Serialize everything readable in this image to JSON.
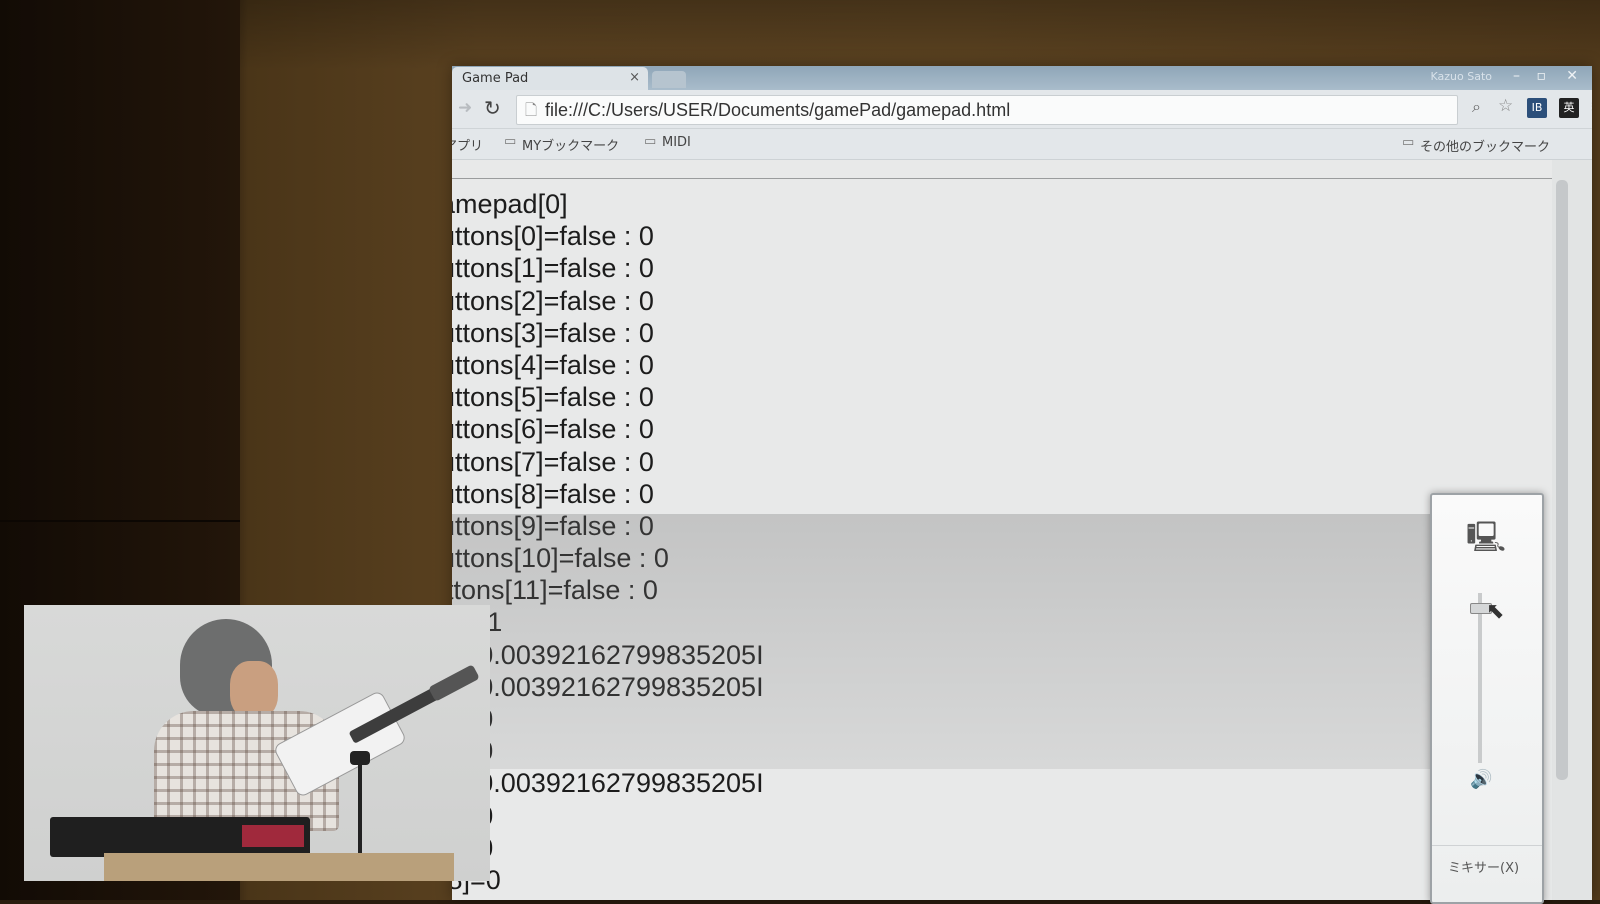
{
  "browser": {
    "tab_title": "Game Pad",
    "tab_close": "×",
    "window_user": "Kazuo Sato",
    "url": "file:///C:/Users/USER/Documents/gamePad/gamepad.html",
    "bookmarks": {
      "apps": "アプリ",
      "folder1": "MYブックマーク",
      "folder2": "MIDI",
      "other": "その他のブックマーク"
    }
  },
  "page": {
    "lines": [
      "amepad[0]",
      "uttons[0]=false : 0",
      "uttons[1]=false : 0",
      "uttons[2]=false : 0",
      "uttons[3]=false : 0",
      "uttons[4]=false : 0",
      "uttons[5]=false : 0",
      "uttons[6]=false : 0",
      "uttons[7]=false : 0",
      "uttons[8]=false : 0",
      "uttons[9]=false : 0",
      "uttons[10]=false : 0",
      "ittons[11]=false : 0",
      "0]=-1",
      "1]=0.00392162799835205I",
      "2]=0.00392162799835205I",
      "3]=0",
      "4]=0",
      "5]=0.00392162799835205I",
      "6]=0",
      "7]=0",
      "[8]=0"
    ]
  },
  "volume_mixer": {
    "mixer_label": "ミキサー(X)",
    "level": 0.92
  },
  "colors": {
    "titlebar": "#8fa6b8",
    "page_background": "#e8e9e9",
    "wall": "#5a4120"
  }
}
